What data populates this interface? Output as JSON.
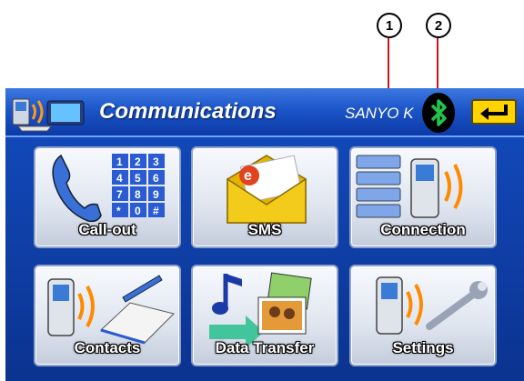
{
  "callouts": [
    "1",
    "2"
  ],
  "header": {
    "title": "Communications",
    "device_name": "SANYO K",
    "icons": {
      "app": "communications-app-icon",
      "bluetooth": "bluetooth-icon",
      "back": "back-arrow-icon"
    }
  },
  "tiles": [
    {
      "label": "Call-out",
      "icon": "phone-keypad-icon",
      "keys": [
        "1",
        "2",
        "3",
        "4",
        "5",
        "6",
        "7",
        "8",
        "9",
        "*",
        "0",
        "#"
      ]
    },
    {
      "label": "SMS",
      "icon": "envelope-icon",
      "badge": "e"
    },
    {
      "label": "Connection",
      "icon": "phone-signal-icon"
    },
    {
      "label": "Contacts",
      "icon": "phone-book-icon"
    },
    {
      "label": "Data Transfer",
      "icon": "media-transfer-icon"
    },
    {
      "label": "Settings",
      "icon": "phone-wrench-icon"
    }
  ],
  "colors": {
    "header": "#1c55c9",
    "bluetooth": "#22c44a",
    "back_button": "#ffd400",
    "callout_line": "#d0121b"
  }
}
